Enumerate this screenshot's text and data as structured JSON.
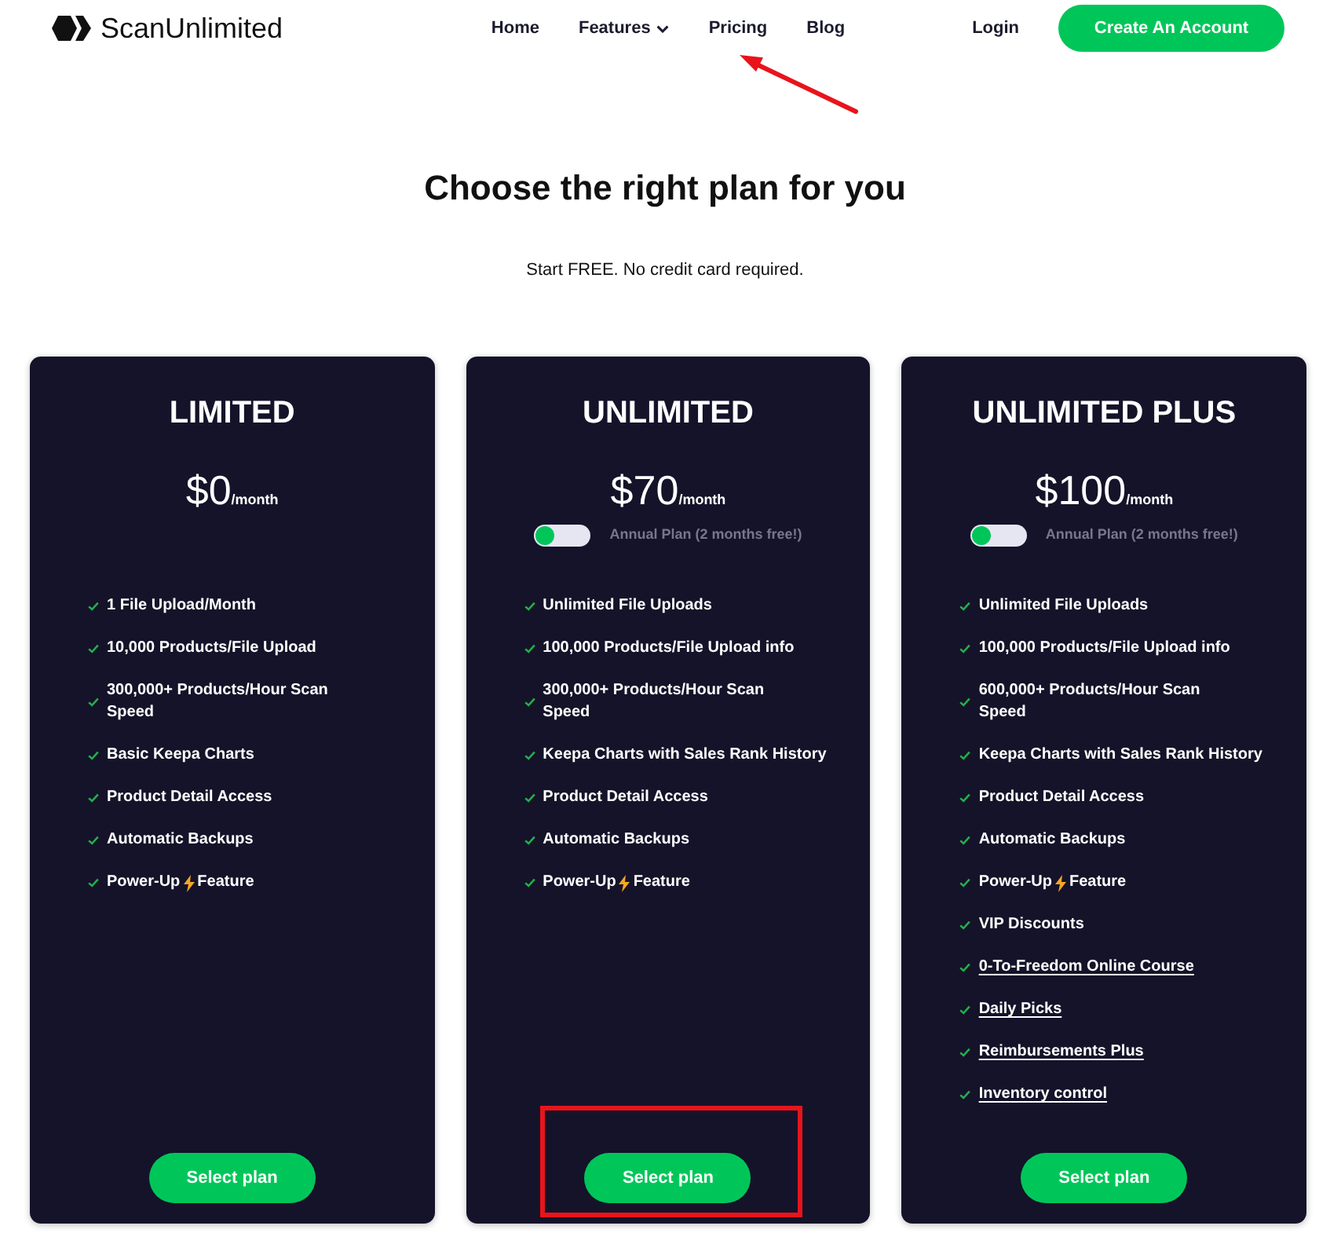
{
  "header": {
    "logo": "ScanUnlimited",
    "nav": [
      {
        "label": "Home",
        "dropdown": false,
        "annotated": false
      },
      {
        "label": "Features",
        "dropdown": true,
        "annotated": false
      },
      {
        "label": "Pricing",
        "dropdown": false,
        "annotated": true
      },
      {
        "label": "Blog",
        "dropdown": false,
        "annotated": false
      }
    ],
    "login": "Login",
    "cta": "Create An Account"
  },
  "title": "Choose the right plan for you",
  "subtitle": "Start FREE. No credit card required.",
  "plans": [
    {
      "name": "LIMITED",
      "price": "$0",
      "period": "/month",
      "features": [
        {
          "kind": "text",
          "text": "1 File Upload/Month"
        },
        {
          "kind": "text",
          "text": "10,000 Products/File Upload"
        },
        {
          "kind": "text",
          "text": "300,000+ Products/Hour Scan\nSpeed"
        },
        {
          "kind": "text",
          "text": "Basic Keepa Charts"
        },
        {
          "kind": "text",
          "text": "Product Detail Access"
        },
        {
          "kind": "text",
          "text": "Automatic Backups"
        },
        {
          "kind": "with_icon",
          "before": "Power-Up",
          "after": "Feature"
        }
      ],
      "button": "Select plan",
      "annotated": false
    },
    {
      "name": "UNLIMITED",
      "price": "$70",
      "period": "/month",
      "annual_toggle": {
        "label": "Annual Plan (2 months free!)",
        "on": false
      },
      "features": [
        {
          "kind": "text",
          "text": "Unlimited File Uploads"
        },
        {
          "kind": "text",
          "text": "100,000 Products/File Upload info"
        },
        {
          "kind": "text",
          "text": "300,000+ Products/Hour Scan\nSpeed"
        },
        {
          "kind": "text",
          "text": "Keepa Charts with Sales Rank History"
        },
        {
          "kind": "text",
          "text": "Product Detail Access"
        },
        {
          "kind": "text",
          "text": "Automatic Backups"
        },
        {
          "kind": "with_icon",
          "before": "Power-Up",
          "after": "Feature"
        }
      ],
      "button": "Select plan",
      "annotated": true
    },
    {
      "name": "UNLIMITED PLUS",
      "price": "$100",
      "period": "/month",
      "annual_toggle": {
        "label": "Annual Plan (2 months free!)",
        "on": false
      },
      "features": [
        {
          "kind": "text",
          "text": "Unlimited File Uploads"
        },
        {
          "kind": "text",
          "text": "100,000 Products/File Upload info"
        },
        {
          "kind": "text",
          "text": "600,000+ Products/Hour Scan\nSpeed"
        },
        {
          "kind": "text",
          "text": "Keepa Charts with Sales Rank History"
        },
        {
          "kind": "text",
          "text": "Product Detail Access"
        },
        {
          "kind": "text",
          "text": "Automatic Backups"
        },
        {
          "kind": "with_icon",
          "before": "Power-Up",
          "after": "Feature"
        },
        {
          "kind": "text",
          "text": "VIP Discounts"
        },
        {
          "kind": "link",
          "text": "0-To-Freedom Online Course"
        },
        {
          "kind": "link",
          "text": "Daily Picks"
        },
        {
          "kind": "link",
          "text": "Reimbursements Plus"
        },
        {
          "kind": "link",
          "text": "Inventory control"
        }
      ],
      "button": "Select plan",
      "annotated": false
    }
  ]
}
